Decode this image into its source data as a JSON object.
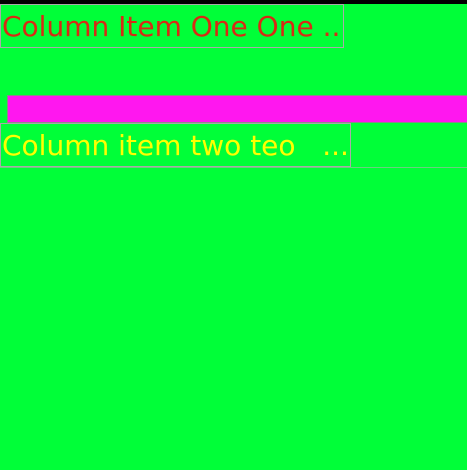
{
  "column": {
    "item_one": {
      "text": "Column Item One One ...",
      "color": "#d82a14"
    },
    "divider_bar": {
      "color": "#ff17ef"
    },
    "item_two": {
      "text": "Column item two teo   ....",
      "color": "#ffff00"
    }
  },
  "colors": {
    "background": "#00ff38",
    "top_strip": "#000000"
  }
}
